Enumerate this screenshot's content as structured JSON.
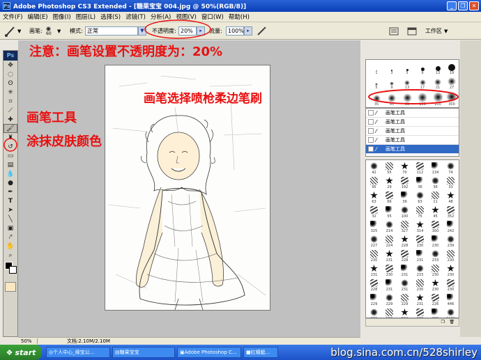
{
  "window": {
    "title": "Adobe Photoshop CS3 Extended - [糖果宝宝 004.jpg @ 50%(RGB/8)]",
    "app_icon": "Ps",
    "min_icon": "minimize-icon",
    "max_icon": "restore-icon",
    "close_icon": "close-icon"
  },
  "menubar": {
    "items": [
      "文件(F)",
      "编辑(E)",
      "图像(I)",
      "图层(L)",
      "选择(S)",
      "滤镜(T)",
      "分析(A)",
      "视图(V)",
      "窗口(W)",
      "帮助(H)"
    ]
  },
  "options": {
    "brush_label": "画笔:",
    "brush_size": "60",
    "mode_label": "模式:",
    "mode_value": "正常",
    "opacity_label": "不透明度:",
    "opacity_value": "20%",
    "flow_label": "流量:",
    "flow_value": "100%",
    "workspace_label": "工作区"
  },
  "annotations": {
    "note_opacity": "注意：画笔设置不透明度为：20%",
    "note_brush_pick": "画笔选择喷枪柔边笔刷",
    "note_tool_line1": "画笔工具",
    "note_tool_line2": "涂抹皮肤颜色"
  },
  "toolbox": {
    "logo": "Ps",
    "tools": [
      "move-tool-icon",
      "marquee-tool-icon",
      "lasso-tool-icon",
      "magic-wand-icon",
      "crop-tool-icon",
      "slice-tool-icon",
      "healing-brush-icon",
      "brush-tool-icon",
      "clone-stamp-icon",
      "history-brush-icon",
      "eraser-icon",
      "gradient-icon",
      "blur-icon",
      "dodge-icon",
      "pen-tool-icon",
      "type-tool-icon",
      "path-select-icon",
      "line-tool-icon",
      "notes-icon",
      "eyedropper-icon",
      "hand-tool-icon",
      "zoom-tool-icon"
    ]
  },
  "brush_panel": {
    "row1": [
      "1",
      "3",
      "5",
      "9",
      "13",
      "19"
    ],
    "row2": [
      "5",
      "9",
      "13",
      "17",
      "21",
      "27"
    ],
    "row3": [
      "35",
      "45",
      "65",
      "100",
      "200",
      "300"
    ]
  },
  "preset_list": {
    "items": [
      "画笔工具",
      "画笔工具",
      "画笔工具",
      "画笔工具",
      "画笔工具"
    ],
    "selected_index": 4
  },
  "brush_grid": {
    "labels": [
      "42",
      "55",
      "70",
      "112",
      "134",
      "74",
      "95",
      "29",
      "192",
      "36",
      "36",
      "33",
      "63",
      "66",
      "39",
      "63",
      "11",
      "48",
      "32",
      "55",
      "100",
      "75",
      "45",
      "352",
      "325",
      "214",
      "327",
      "314",
      "160",
      "242",
      "227",
      "224",
      "228",
      "230",
      "230",
      "239",
      "230",
      "231",
      "228",
      "231",
      "233",
      "230",
      "231",
      "230",
      "231",
      "233",
      "230",
      "230",
      "228",
      "231",
      "231",
      "230",
      "230",
      "230",
      "229",
      "229",
      "229",
      "231",
      "226",
      "446",
      "589",
      "583",
      "584",
      "678",
      "339",
      "1200"
    ]
  },
  "statusbar": {
    "zoom": "50%",
    "docinfo": "文档:2.10M/2.10M"
  },
  "taskbar": {
    "start_label": "start",
    "buttons": [
      "个人中心_缘宝公...",
      "糖果宝宝",
      "Adobe Photoshop C...",
      "红蜻蜓..."
    ]
  },
  "watermark": "blog.sina.com.cn/528shirley"
}
